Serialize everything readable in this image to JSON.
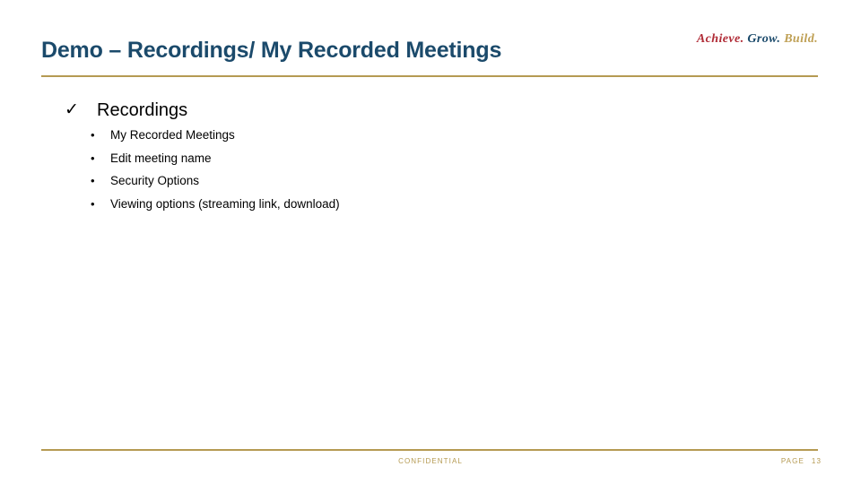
{
  "slide": {
    "title": "Demo – Recordings/ My Recorded Meetings",
    "brand": {
      "word1": "Achieve.",
      "word2": "Grow.",
      "word3": "Build.",
      "color1": "#b02b36",
      "color2": "#1b4a6b",
      "color3": "#bfa055"
    },
    "rule_color": "#b59a52",
    "title_color": "#1b4a6b",
    "content": {
      "section": {
        "bullet_glyph": "✓",
        "label": "Recordings",
        "items": [
          {
            "bullet_glyph": "•",
            "label": "My Recorded Meetings"
          },
          {
            "bullet_glyph": "•",
            "label": "Edit meeting name"
          },
          {
            "bullet_glyph": "•",
            "label": "Security Options"
          },
          {
            "bullet_glyph": "•",
            "label": "Viewing options (streaming link, download)"
          }
        ]
      }
    },
    "footer": {
      "confidential": "CONFIDENTIAL",
      "page_label": "PAGE",
      "page_number": "13",
      "color": "#b59a52"
    }
  }
}
